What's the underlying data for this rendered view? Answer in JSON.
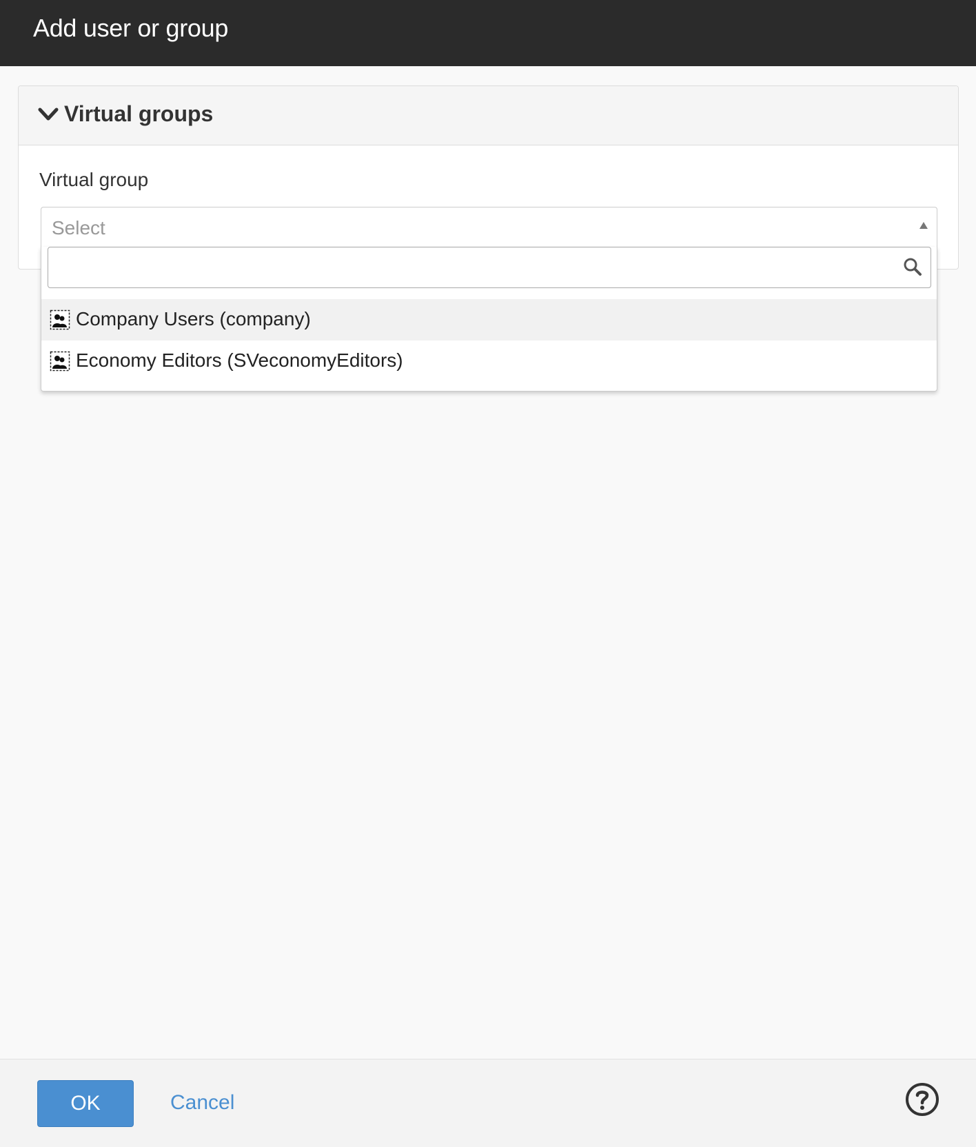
{
  "dialog": {
    "title": "Add user or group"
  },
  "panel": {
    "title": "Virtual groups",
    "field_label": "Virtual group",
    "select_placeholder": "Select",
    "search_value": "",
    "options": [
      {
        "label": "Company Users (company)",
        "icon": "group-icon",
        "highlighted": true
      },
      {
        "label": "Economy Editors (SVeconomyEditors)",
        "icon": "group-icon",
        "highlighted": false
      }
    ]
  },
  "footer": {
    "ok_label": "OK",
    "cancel_label": "Cancel",
    "help_icon": "help-icon"
  },
  "colors": {
    "titlebar": "#2b2b2b",
    "primary": "#4a8fd1",
    "highlight": "#f1f1f1"
  }
}
